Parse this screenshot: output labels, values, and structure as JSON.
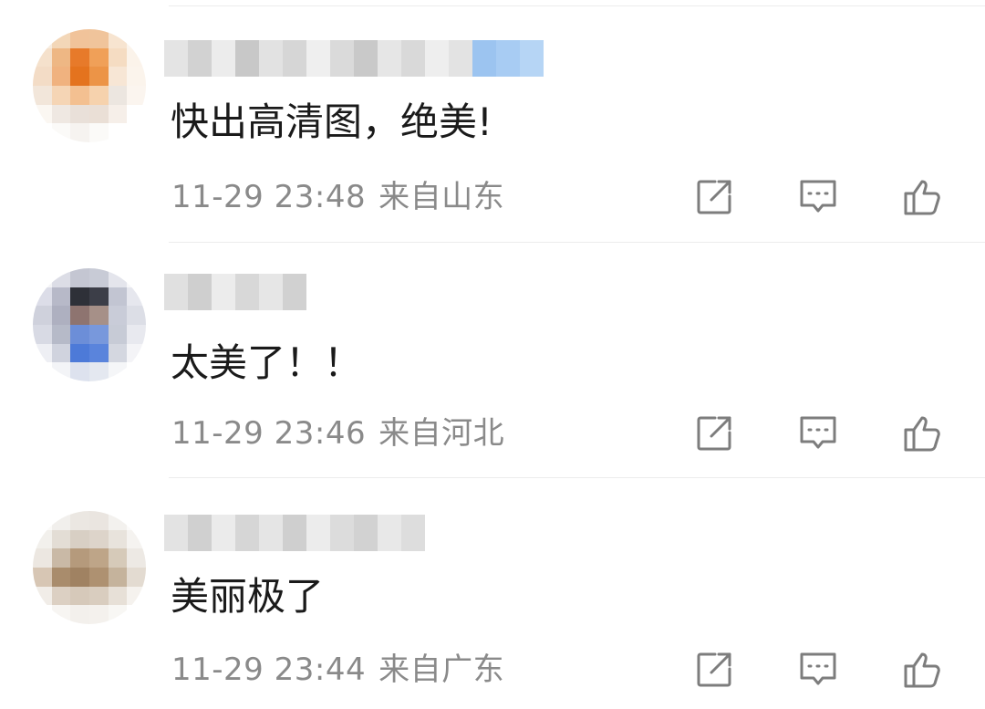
{
  "comments": [
    {
      "text": "快出高清图，绝美!",
      "time": "11-29 23:48",
      "location": "来自山东",
      "avatar_colors": [
        "#f7ecdf",
        "#f3d7b8",
        "#f1c39a",
        "#f0c49b",
        "#f7e4d0",
        "#fbf4ec",
        "#f5e1cc",
        "#eeb784",
        "#e77a2a",
        "#f0a058",
        "#f5dcc2",
        "#fbf3ea",
        "#f3dcc6",
        "#f0b27f",
        "#e4731e",
        "#ec9447",
        "#f7e6d5",
        "#fbf4ec",
        "#f2e6da",
        "#f5d5b5",
        "#f3c091",
        "#f6d2ad",
        "#ece6e0",
        "#fbf5ef",
        "#fbf7f2",
        "#efe8e2",
        "#e9e0d9",
        "#eadfd6",
        "#f6efe9",
        "#ffffff",
        "#ffffff",
        "#fbfaf8",
        "#f6f3f0",
        "#fbfaf8",
        "#ffffff",
        "#ffffff"
      ],
      "username_colors": [
        "#e4e4e4",
        "#d2d2d2",
        "#ececec",
        "#c8c8c8",
        "#e2e2e2",
        "#d6d6d6",
        "#efefef",
        "#dadada",
        "#c9c9c9",
        "#e6e6e6",
        "#d9d9d9",
        "#eeeeee",
        "#e3e3e3",
        "#9cc4f0",
        "#a8ccf3",
        "#b6d5f5"
      ]
    },
    {
      "text": "太美了！！",
      "time": "11-29 23:46",
      "location": "来自河北",
      "avatar_colors": [
        "#f4f4f6",
        "#dcdde6",
        "#c4c6d2",
        "#c8cbd6",
        "#e4e5ec",
        "#f7f7f9",
        "#dcdde8",
        "#b7b9c8",
        "#2e3038",
        "#3c3e48",
        "#c2c5d2",
        "#e6e7ee",
        "#cfd1dc",
        "#aeb0c0",
        "#8e7470",
        "#a69088",
        "#c9ccd8",
        "#dcdee6",
        "#d8dae4",
        "#b6bac8",
        "#6c8ed8",
        "#7898dc",
        "#c7cbd6",
        "#e8e9ef",
        "#eeeff4",
        "#d0d3de",
        "#4d7ad8",
        "#5a84dc",
        "#d4d7e0",
        "#f4f4f7",
        "#ffffff",
        "#f3f4f7",
        "#dde2ee",
        "#e4e8f0",
        "#f5f6f8",
        "#ffffff"
      ],
      "username_colors": [
        "#e0e0e0",
        "#cfcfcf",
        "#ececec",
        "#d8d8d8",
        "#e6e6e6",
        "#d1d1d1"
      ]
    },
    {
      "text": "美丽极了",
      "time": "11-29 23:44",
      "location": "来自广东",
      "avatar_colors": [
        "#fbfaf8",
        "#f1efec",
        "#ebe7e2",
        "#eae5e0",
        "#f3f1ee",
        "#fbfaf9",
        "#f2f0ec",
        "#e3ddd5",
        "#d8cfc4",
        "#ddd4ca",
        "#e8e3dc",
        "#f5f3f0",
        "#ece7e1",
        "#c9b9a6",
        "#b59a7c",
        "#bea588",
        "#d6cab9",
        "#ede9e4",
        "#d7c6b4",
        "#a98c6c",
        "#a08262",
        "#ae9171",
        "#c5b39c",
        "#e3dbd1",
        "#f1ede8",
        "#dcd0c3",
        "#d6c9ba",
        "#d9cdbf",
        "#e7e0d7",
        "#f5f2ee",
        "#ffffff",
        "#f7f5f2",
        "#f3f0ec",
        "#f4f1ed",
        "#f8f7f4",
        "#ffffff"
      ],
      "username_colors": [
        "#e3e3e3",
        "#d0d0d0",
        "#ebebeb",
        "#d6d6d6",
        "#e5e5e5",
        "#cfcfcf",
        "#ececec",
        "#dcdcdc",
        "#d2d2d2",
        "#e8e8e8",
        "#dddddd"
      ]
    }
  ],
  "icons": {
    "forward": "share-edit-icon",
    "comment": "comment-bubble-icon",
    "like": "thumbs-up-icon"
  },
  "colors": {
    "text": "#1a1a1a",
    "meta": "#8a8a8a",
    "icon": "#7d7d7d",
    "divider": "#ececec"
  }
}
